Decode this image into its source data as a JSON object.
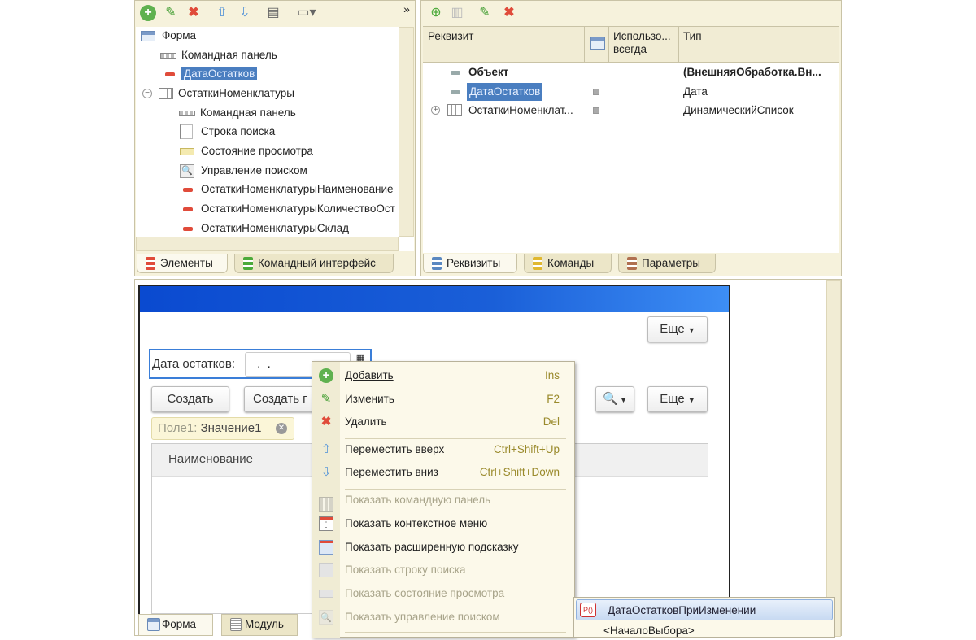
{
  "elements_panel": {
    "toolbar_icons": [
      "add-icon",
      "edit-icon",
      "delete-icon",
      "move-up-icon",
      "move-down-icon",
      "form-preview-icon",
      "layout-icon"
    ],
    "more_label": "»",
    "tree": [
      {
        "label": "Форма",
        "icon": "form-icon",
        "level": 0
      },
      {
        "label": "Командная панель",
        "icon": "command-panel-icon",
        "level": 1
      },
      {
        "label": "ДатаОстатков",
        "icon": "field-icon",
        "level": 1,
        "selected": true
      },
      {
        "label": "ОстаткиНоменклатуры",
        "icon": "table-icon",
        "level": 1,
        "expanded": true
      },
      {
        "label": "Командная панель",
        "icon": "command-panel-icon",
        "level": 2
      },
      {
        "label": "Строка поиска",
        "icon": "search-string-icon",
        "level": 2
      },
      {
        "label": "Состояние просмотра",
        "icon": "view-state-icon",
        "level": 2
      },
      {
        "label": "Управление поиском",
        "icon": "search-control-icon",
        "level": 2
      },
      {
        "label": "ОстаткиНоменклатурыНаименование",
        "icon": "field-icon",
        "level": 2
      },
      {
        "label": "ОстаткиНоменклатурыКоличествоОст",
        "icon": "field-icon",
        "level": 2
      },
      {
        "label": "ОстаткиНоменклатурыСклад",
        "icon": "field-icon",
        "level": 2
      }
    ],
    "tabs": [
      {
        "label": "Элементы",
        "active": true
      },
      {
        "label": "Командный интерфейс"
      }
    ]
  },
  "attributes_panel": {
    "columns": {
      "attribute": "Реквизит",
      "use_always": "Использо... всегда",
      "type": "Тип"
    },
    "rows": [
      {
        "name": "Объект",
        "type": "(ВнешняяОбработка.Вн...",
        "bold": true
      },
      {
        "name": "ДатаОстатков",
        "type": "Дата",
        "selected": true
      },
      {
        "name": "ОстаткиНоменклат...",
        "type": "ДинамическийСписок",
        "expandable": true
      }
    ],
    "tabs": [
      {
        "label": "Реквизиты",
        "active": true
      },
      {
        "label": "Команды"
      },
      {
        "label": "Параметры"
      }
    ]
  },
  "preview": {
    "more_top": "Еще",
    "date_label": "Дата остатков:",
    "date_value": " .  .",
    "create": "Создать",
    "create_group": "Создать г",
    "more": "Еще",
    "filter_chip": {
      "field": "Поле1:",
      "value": "Значение1"
    },
    "column_name": "Наименование"
  },
  "bottom_tabs": [
    {
      "label": "Форма",
      "active": true
    },
    {
      "label": "Модуль"
    }
  ],
  "context_menu": [
    {
      "label": "Добавить",
      "shortcut": "Ins",
      "icon": "add-icon"
    },
    {
      "label": "Изменить",
      "shortcut": "F2",
      "icon": "edit-icon"
    },
    {
      "label": "Удалить",
      "shortcut": "Del",
      "icon": "delete-icon"
    },
    {
      "label": "Переместить вверх",
      "shortcut": "Ctrl+Shift+Up",
      "icon": "move-up-icon"
    },
    {
      "label": "Переместить вниз",
      "shortcut": "Ctrl+Shift+Down",
      "icon": "move-down-icon"
    },
    {
      "label": "Показать командную панель",
      "disabled": true,
      "icon": "command-panel-icon"
    },
    {
      "label": "Показать контекстное меню",
      "icon": "context-menu-icon"
    },
    {
      "label": "Показать расширенную подсказку",
      "icon": "tooltip-icon"
    },
    {
      "label": "Показать строку поиска",
      "disabled": true,
      "icon": "search-string-icon"
    },
    {
      "label": "Показать состояние просмотра",
      "disabled": true,
      "icon": "view-state-icon"
    },
    {
      "label": "Показать управление поиском",
      "disabled": true,
      "icon": "search-control-icon"
    }
  ],
  "procedure_list": {
    "icon_label": "P()",
    "items": [
      "ДатаОстатковПриИзменении",
      "<НачалоВыбора>"
    ]
  },
  "colors": {
    "selection": "#4a7ec0",
    "title_bar": "#1a5fd8",
    "panel": "#f6f2dc",
    "menu": "#fcf9ea"
  }
}
